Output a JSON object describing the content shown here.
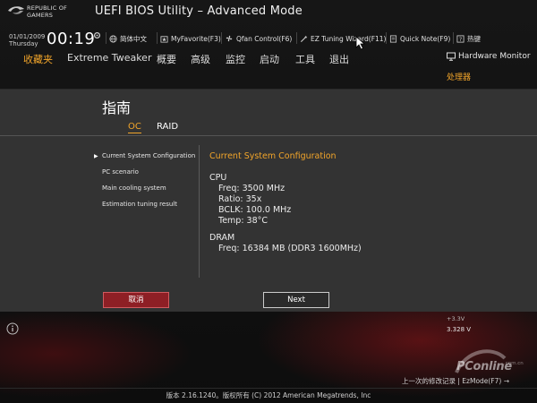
{
  "header": {
    "logo_text": "REPUBLIC OF GAMERS",
    "title": "UEFI BIOS Utility – Advanced Mode",
    "date": "01/01/2009",
    "weekday": "Thursday",
    "time": "00:19",
    "tools": [
      {
        "label": "简体中文",
        "icon": "globe-icon"
      },
      {
        "label": "MyFavorite(F3)",
        "icon": "star-icon"
      },
      {
        "label": "Qfan Control(F6)",
        "icon": "fan-icon"
      },
      {
        "label": "EZ Tuning Wizard(F11)",
        "icon": "wizard-icon"
      },
      {
        "label": "Quick Note(F9)",
        "icon": "note-icon"
      },
      {
        "label": "热键",
        "icon": "hotkey-icon"
      }
    ]
  },
  "menu": {
    "items": [
      "收藏夹",
      "Extreme Tweaker",
      "概要",
      "高级",
      "监控",
      "启动",
      "工具",
      "退出"
    ],
    "active": "收藏夹"
  },
  "hardware_monitor": {
    "title": "Hardware Monitor",
    "subtitle": "处理器"
  },
  "panel": {
    "title": "指南",
    "tabs": [
      {
        "label": "OC",
        "active": true
      },
      {
        "label": "RAID",
        "active": false
      }
    ],
    "nav": [
      "Current System Configuration",
      "PC scenario",
      "Main cooling system",
      "Estimation tuning result"
    ],
    "content": {
      "heading": "Current System Configuration",
      "cpu_label": "CPU",
      "cpu_lines": [
        "Freq: 3500 MHz",
        "Ratio: 35x",
        "BCLK: 100.0 MHz",
        "Temp: 38°C"
      ],
      "dram_label": "DRAM",
      "dram_lines": [
        "Freq: 16384 MB (DDR3 1600MHz)"
      ]
    },
    "buttons": {
      "cancel": "取消",
      "next": "Next"
    }
  },
  "bottom": {
    "voltage_label": "+3.3V",
    "voltage_value": "3.328 V",
    "last_modified": "上一次的修改记录 | EzMode(F7) →",
    "version": "版本 2.16.1240。版权所有 (C) 2012 American Megatrends, Inc",
    "watermark": "PConline",
    "watermark_domain": ".com.cn"
  },
  "colors": {
    "accent": "#f2a52a",
    "panel_bg": "#333333",
    "cancel_bg": "#8e1f25",
    "brand_red": "#b3161d"
  }
}
